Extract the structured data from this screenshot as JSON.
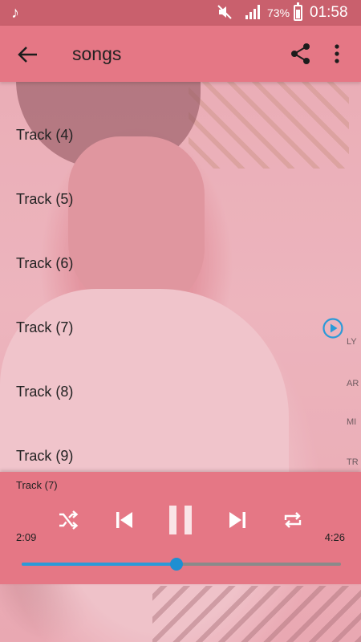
{
  "status_bar": {
    "music_icon": "music-note-icon",
    "battery_percent": "73%",
    "time": "01:58"
  },
  "toolbar": {
    "title": "songs",
    "back_icon": "arrow-back-icon",
    "share_icon": "share-icon",
    "more_icon": "more-vert-icon"
  },
  "tracks": [
    {
      "label": "Track (4)"
    },
    {
      "label": "Track (5)"
    },
    {
      "label": "Track (6)"
    },
    {
      "label": "Track (7)",
      "playing": true
    },
    {
      "label": "Track (8)"
    },
    {
      "label": "Track (9)"
    }
  ],
  "player": {
    "now_playing": "Track (7)",
    "elapsed": "2:09",
    "total": "4:26",
    "progress_fraction": 0.485
  },
  "colors": {
    "accent": "#e57785",
    "status_bar": "#c9606d",
    "seek_fill": "#2b9ad8"
  }
}
